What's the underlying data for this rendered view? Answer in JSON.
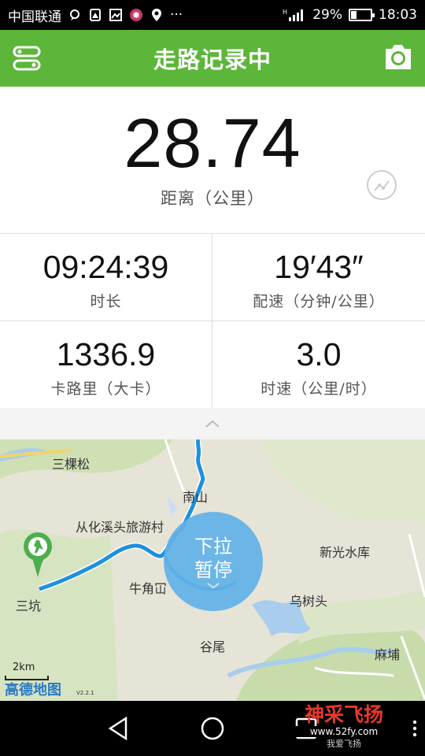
{
  "status_bar": {
    "carrier": "中国联通",
    "battery_percent": "29%",
    "battery_level": 0.29,
    "time": "18:03",
    "overflow": "···"
  },
  "header": {
    "title": "走路记录中",
    "menu_icon": "menu-toggle-icon",
    "camera_icon": "camera-icon",
    "color": "#5cb63a"
  },
  "distance": {
    "value": "28.74",
    "label": "距离（公里）",
    "trend_icon": "trend-chart-icon"
  },
  "stats": [
    {
      "value": "09:24:39",
      "label": "时长"
    },
    {
      "value": "19′43″",
      "label": "配速（分钟/公里）"
    },
    {
      "value": "1336.9",
      "label": "卡路里（大卡）"
    },
    {
      "value": "3.0",
      "label": "时速（公里/时）"
    }
  ],
  "map": {
    "places": [
      "三棵松",
      "南山",
      "从化溪头旅游村",
      "新光水库",
      "牛角冚",
      "乌树头",
      "三坑",
      "谷尾",
      "麻埔"
    ],
    "pause_button": {
      "line1": "下拉",
      "line2": "暂停"
    },
    "scale": "2km",
    "provider": "高德地图",
    "version": "V2.2.1",
    "route_color": "#1e90e0"
  },
  "watermark": {
    "main": "神采飞扬",
    "url": "www.52fy.com",
    "sub": "我爱飞扬"
  }
}
